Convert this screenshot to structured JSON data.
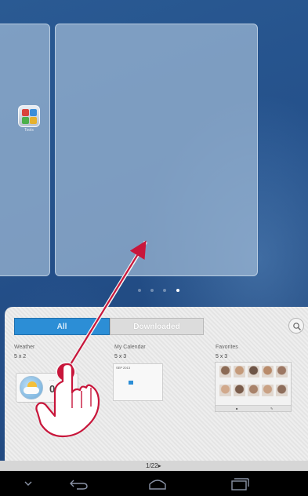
{
  "home": {
    "app_label": "Tools",
    "page_dots": {
      "count": 4,
      "active_index": 3
    }
  },
  "widget_drawer": {
    "tabs": [
      {
        "label": "All",
        "selected": true
      },
      {
        "label": "Downloaded",
        "selected": false
      }
    ],
    "search_icon": "search-icon",
    "widgets": [
      {
        "name": "Weather",
        "size": "5 x 2",
        "temp": "09"
      },
      {
        "name": "My Calendar",
        "size": "5 x 3",
        "month": "SEP 2013"
      },
      {
        "name": "Favorites",
        "size": "5 x 3"
      }
    ],
    "page_indicator": "1/22",
    "page_indicator_arrow": "▸"
  },
  "nav_bar": {
    "buttons": [
      "chevron-down-icon",
      "back-icon",
      "home-icon",
      "recent-apps-icon"
    ]
  },
  "gesture": {
    "type": "drag",
    "from_label": "Weather widget",
    "to_label": "home screen panel"
  },
  "colors": {
    "accent": "#2c8ed6",
    "touch": "#c8163b"
  }
}
